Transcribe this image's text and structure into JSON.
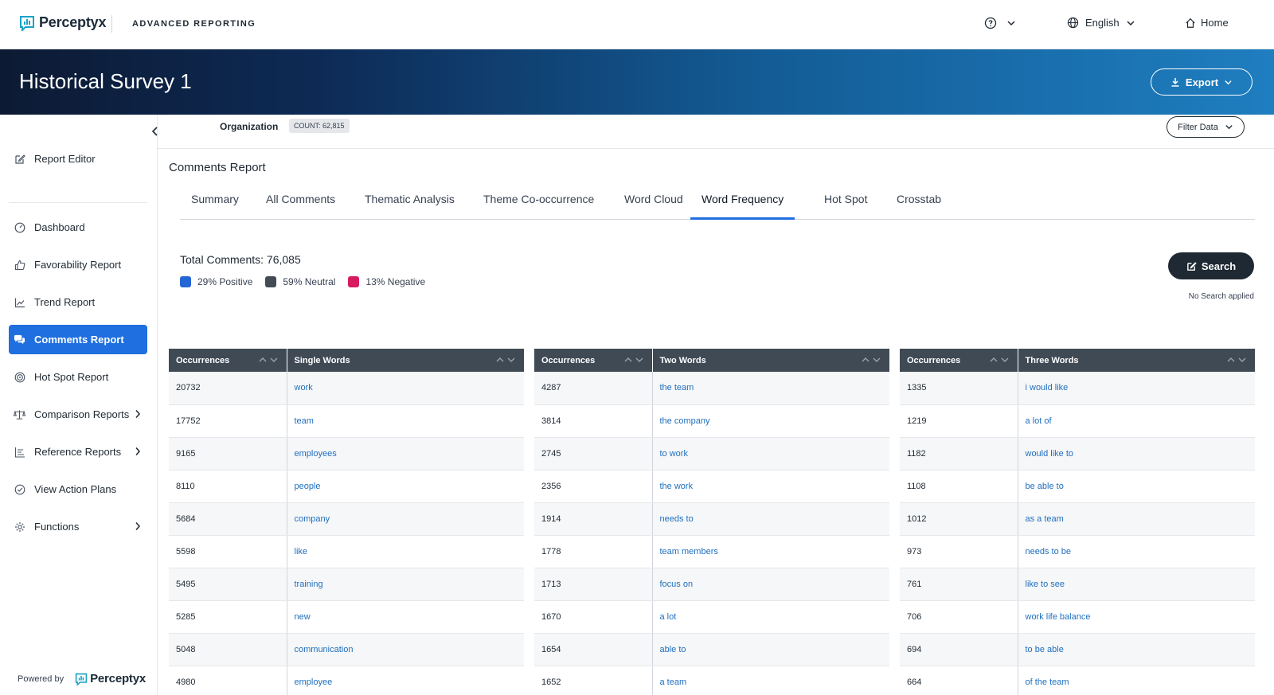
{
  "topbar": {
    "logo_text": "Perceptyx",
    "app_title": "ADVANCED REPORTING",
    "language": "English",
    "home": "Home"
  },
  "banner": {
    "survey_title": "Historical Survey 1",
    "export_label": "Export"
  },
  "sidebar": {
    "items": [
      {
        "label": "Report Editor",
        "icon": "edit-icon"
      },
      {
        "label": "Dashboard",
        "icon": "gauge-icon"
      },
      {
        "label": "Favorability Report",
        "icon": "thumbs-up-icon"
      },
      {
        "label": "Trend Report",
        "icon": "trend-icon"
      },
      {
        "label": "Comments Report",
        "icon": "comments-icon",
        "active": true
      },
      {
        "label": "Hot Spot Report",
        "icon": "target-icon"
      },
      {
        "label": "Comparison Reports",
        "icon": "scale-icon",
        "has_submenu": true
      },
      {
        "label": "Reference Reports",
        "icon": "list-icon",
        "has_submenu": true
      },
      {
        "label": "View Action Plans",
        "icon": "check-circle-icon"
      },
      {
        "label": "Functions",
        "icon": "gear-icon",
        "has_submenu": true
      }
    ],
    "powered_by": "Powered by",
    "powered_logo": "Perceptyx"
  },
  "filterbar": {
    "organization": "Organization",
    "count": "COUNT: 62,815",
    "filter_label": "Filter Data"
  },
  "report": {
    "title": "Comments Report",
    "tabs": [
      "Summary",
      "All Comments",
      "Thematic Analysis",
      "Theme Co-occurrence",
      "Word Cloud",
      "Word Frequency",
      "Hot Spot",
      "Crosstab"
    ],
    "active_tab": "Word Frequency",
    "total_comments": "Total Comments: 76,085",
    "legend": [
      {
        "label": "29% Positive",
        "color": "#2466d6"
      },
      {
        "label": "59% Neutral",
        "color": "#444b55"
      },
      {
        "label": "13% Negative",
        "color": "#d81b60"
      }
    ],
    "search_label": "Search",
    "search_status": "No Search applied"
  },
  "tables": [
    {
      "col1": "Occurrences",
      "col2": "Single Words",
      "rows": [
        [
          "20732",
          "work"
        ],
        [
          "17752",
          "team"
        ],
        [
          "9165",
          "employees"
        ],
        [
          "8110",
          "people"
        ],
        [
          "5684",
          "company"
        ],
        [
          "5598",
          "like"
        ],
        [
          "5495",
          "training"
        ],
        [
          "5285",
          "new"
        ],
        [
          "5048",
          "communication"
        ],
        [
          "4980",
          "employee"
        ]
      ]
    },
    {
      "col1": "Occurrences",
      "col2": "Two Words",
      "rows": [
        [
          "4287",
          "the team"
        ],
        [
          "3814",
          "the company"
        ],
        [
          "2745",
          "to work"
        ],
        [
          "2356",
          "the work"
        ],
        [
          "1914",
          "needs to"
        ],
        [
          "1778",
          "team members"
        ],
        [
          "1713",
          "focus on"
        ],
        [
          "1670",
          "a lot"
        ],
        [
          "1654",
          "able to"
        ],
        [
          "1652",
          "a team"
        ]
      ]
    },
    {
      "col1": "Occurrences",
      "col2": "Three Words",
      "rows": [
        [
          "1335",
          "i would like"
        ],
        [
          "1219",
          "a lot of"
        ],
        [
          "1182",
          "would like to"
        ],
        [
          "1108",
          "be able to"
        ],
        [
          "1012",
          "as a team"
        ],
        [
          "973",
          "needs to be"
        ],
        [
          "761",
          "like to see"
        ],
        [
          "706",
          "work life balance"
        ],
        [
          "694",
          "to be able"
        ],
        [
          "664",
          "of the team"
        ]
      ]
    }
  ]
}
